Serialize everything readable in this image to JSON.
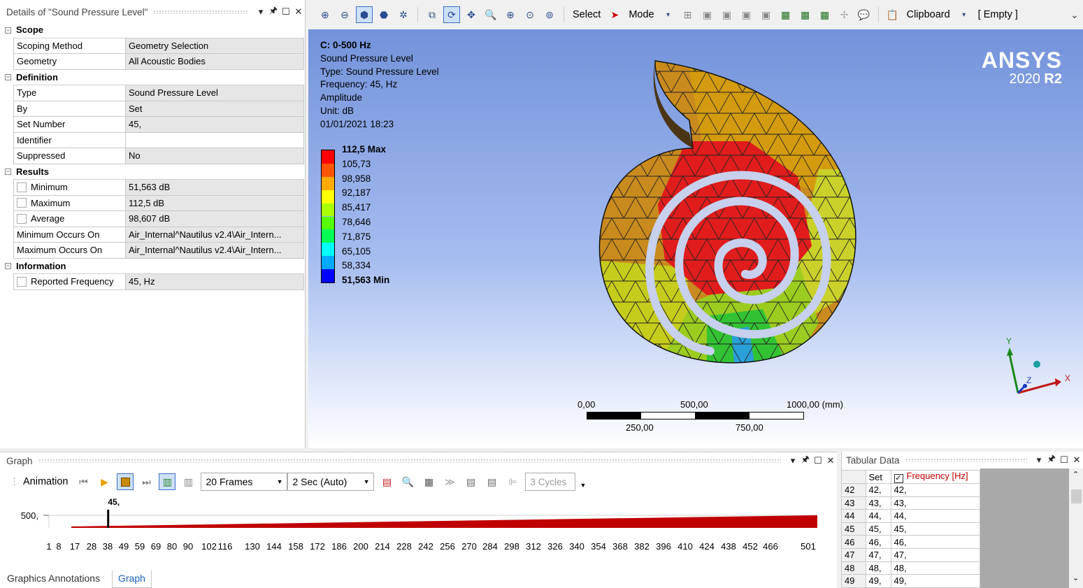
{
  "details": {
    "title": "Details of \"Sound Pressure Level\"",
    "categories": [
      {
        "label": "Scope",
        "rows": [
          {
            "key": "Scoping Method",
            "value": "Geometry Selection"
          },
          {
            "key": "Geometry",
            "value": "All Acoustic Bodies"
          }
        ]
      },
      {
        "label": "Definition",
        "rows": [
          {
            "key": "Type",
            "value": "Sound Pressure Level"
          },
          {
            "key": "By",
            "value": "Set"
          },
          {
            "key": "Set Number",
            "value": "45,"
          },
          {
            "key": "Identifier",
            "value": ""
          },
          {
            "key": "Suppressed",
            "value": "No"
          }
        ]
      },
      {
        "label": "Results",
        "rows": [
          {
            "key": "Minimum",
            "value": "51,563 dB"
          },
          {
            "key": "Maximum",
            "value": "112,5 dB"
          },
          {
            "key": "Average",
            "value": "98,607 dB"
          },
          {
            "key": "Minimum Occurs On",
            "value": "Air_Internal^Nautilus v2.4\\Air_Intern..."
          },
          {
            "key": "Maximum Occurs On",
            "value": "Air_Internal^Nautilus v2.4\\Air_Intern..."
          }
        ]
      },
      {
        "label": "Information",
        "rows": [
          {
            "key": "Reported Frequency",
            "value": "45, Hz"
          }
        ]
      }
    ]
  },
  "toolbar": {
    "select_label": "Select",
    "mode_label": "Mode",
    "clipboard_label": "Clipboard",
    "empty_label": "[ Empty ]"
  },
  "viewport": {
    "info_title": "C: 0-500 Hz",
    "info_lines": [
      "Sound Pressure Level",
      "Type: Sound Pressure Level",
      "Frequency: 45, Hz",
      "Amplitude",
      "Unit: dB",
      "01/01/2021 18:23"
    ],
    "legend_max": "112,5 Max",
    "legend_min": "51,563 Min",
    "legend_values": [
      "105,73",
      "98,958",
      "92,187",
      "85,417",
      "78,646",
      "71,875",
      "65,105",
      "58,334"
    ],
    "legend_colors": [
      "#ff0000",
      "#ff5500",
      "#ffaa00",
      "#ffff00",
      "#aaff00",
      "#55ff00",
      "#00ff55",
      "#00ffff",
      "#00aaff",
      "#0000ff"
    ],
    "brand": "ANSYS",
    "version_prefix": "2020 ",
    "version_suffix": "R2",
    "scale_top": [
      "0,00",
      "500,00",
      "1000,00 (mm)"
    ],
    "scale_bottom": [
      "250,00",
      "750,00"
    ],
    "axis_x": "X",
    "axis_y": "Y",
    "axis_z": "Z"
  },
  "graph": {
    "title": "Graph",
    "animation_label": "Animation",
    "frames": "20 Frames",
    "duration": "2 Sec (Auto)",
    "cycles": "3 Cycles",
    "y_tick": "500,",
    "marker_label": "45,",
    "marker_value": 45,
    "x_max": 501,
    "x_ticks": [
      "1",
      "8",
      "17",
      "28",
      "38",
      "49",
      "59",
      "69",
      "80",
      "90",
      "102",
      "116",
      "130",
      "144",
      "158",
      "172",
      "186",
      "200",
      "214",
      "228",
      "242",
      "256",
      "270",
      "284",
      "298",
      "312",
      "326",
      "340",
      "354",
      "368",
      "382",
      "396",
      "410",
      "424",
      "438",
      "452",
      "466",
      "501"
    ]
  },
  "tabular": {
    "title": "Tabular Data",
    "col_set": "Set",
    "col_freq": "Frequency [Hz]",
    "rows": [
      {
        "n": "42",
        "set": "42,",
        "freq": "42,"
      },
      {
        "n": "43",
        "set": "43,",
        "freq": "43,"
      },
      {
        "n": "44",
        "set": "44,",
        "freq": "44,"
      },
      {
        "n": "45",
        "set": "45,",
        "freq": "45,"
      },
      {
        "n": "46",
        "set": "46,",
        "freq": "46,"
      },
      {
        "n": "47",
        "set": "47,",
        "freq": "47,"
      },
      {
        "n": "48",
        "set": "48,",
        "freq": "48,"
      },
      {
        "n": "49",
        "set": "49,",
        "freq": "49,"
      }
    ]
  },
  "bottom_tabs": [
    "Graphics Annotations",
    "Graph"
  ]
}
